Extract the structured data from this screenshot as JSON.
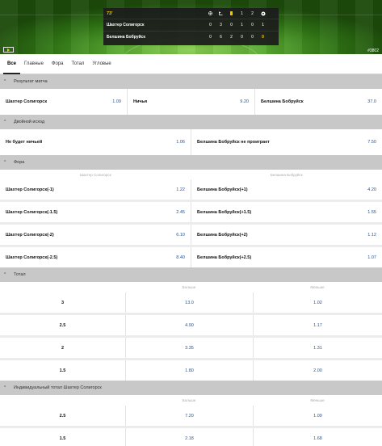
{
  "scoreboard": {
    "time": "73'",
    "col_labels": [
      "1",
      "2"
    ],
    "teams": [
      {
        "name": "Шахтер Солигорск",
        "stats": [
          "0",
          "3",
          "0",
          "1",
          "0"
        ],
        "total": "1"
      },
      {
        "name": "Белшина Бобруйск",
        "stats": [
          "0",
          "6",
          "2",
          "0",
          "0"
        ],
        "total": "0"
      }
    ]
  },
  "event_id": "#3802",
  "tabs": [
    "Все",
    "Главные",
    "Фора",
    "Тотал",
    "Угловые"
  ],
  "sections": {
    "result": {
      "title": "Результат матча",
      "items": [
        {
          "label": "Шахтер Солигорск",
          "odd": "1.09"
        },
        {
          "label": "Ничья",
          "odd": "9.20"
        },
        {
          "label": "Белшина Бобруйск",
          "odd": "37.0"
        }
      ]
    },
    "double": {
      "title": "Двойной исход",
      "items": [
        {
          "label": "Не будет ничьей",
          "odd": "1.06"
        },
        {
          "label": "Белшина Бобруйск не проиграет",
          "odd": "7.50"
        }
      ]
    },
    "handicap": {
      "title": "Фора",
      "col_home": "Шахтер Солигорск",
      "col_away": "Белшина Бобруйск",
      "rows": [
        {
          "home": "Шахтер Солигорск(-1)",
          "home_odd": "1.22",
          "away": "Белшина Бобруйск(+1)",
          "away_odd": "4.20"
        },
        {
          "home": "Шахтер Солигорск(-1.5)",
          "home_odd": "2.45",
          "away": "Белшина Бобруйск(+1.5)",
          "away_odd": "1.55"
        },
        {
          "home": "Шахтер Солигорск(-2)",
          "home_odd": "6.10",
          "away": "Белшина Бобруйск(+2)",
          "away_odd": "1.12"
        },
        {
          "home": "Шахтер Солигорск(-2.5)",
          "home_odd": "8.40",
          "away": "Белшина Бобруйск(+2.5)",
          "away_odd": "1.07"
        }
      ]
    },
    "total": {
      "title": "Тотал",
      "col_over": "Больше",
      "col_under": "Меньше",
      "rows": [
        {
          "line": "3",
          "over": "13.0",
          "under": "1.02"
        },
        {
          "line": "2.5",
          "over": "4.90",
          "under": "1.17"
        },
        {
          "line": "2",
          "over": "3.35",
          "under": "1.31"
        },
        {
          "line": "1.5",
          "over": "1.80",
          "under": "2.00"
        }
      ]
    },
    "ind_total": {
      "title": "Индивидуальный тотал Шахтер Солигорск",
      "col_over": "Больше",
      "col_under": "Меньше",
      "rows": [
        {
          "line": "2.5",
          "over": "7.20",
          "under": "1.09"
        },
        {
          "line": "1.5",
          "over": "2.18",
          "under": "1.68"
        }
      ]
    }
  },
  "colors": {
    "odd": "#2c5490",
    "section_header": "#c8c8c8",
    "score_accent": "#f6d000"
  }
}
